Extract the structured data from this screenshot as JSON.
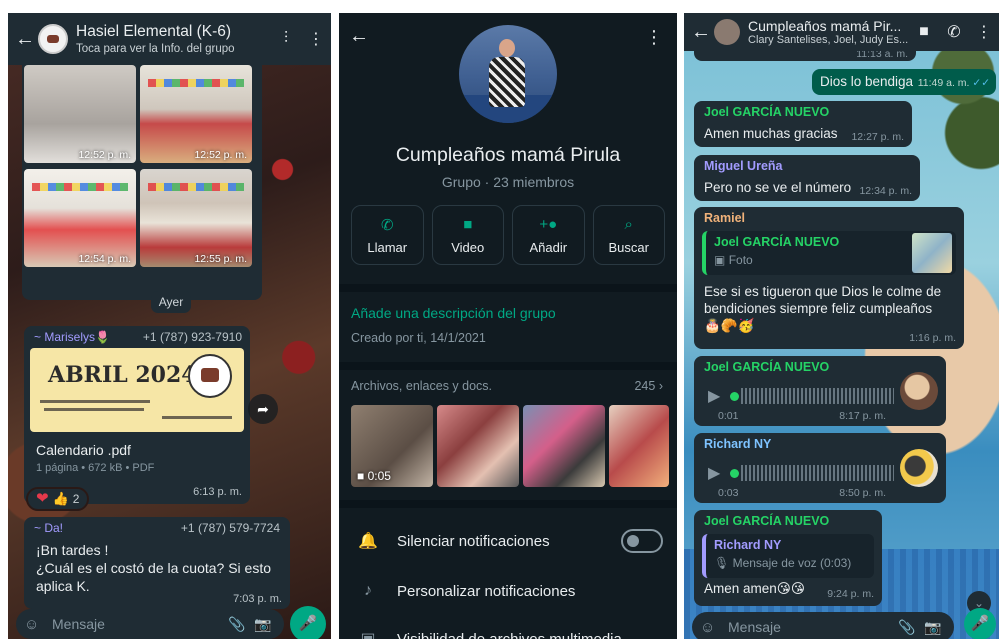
{
  "panel1": {
    "title": "Hasiel Elemental (K-6)",
    "subtitle": "Toca para ver la Info. del grupo",
    "images": [
      {
        "time": "12:52 p. m."
      },
      {
        "time": "12:52 p. m."
      },
      {
        "time": "12:54 p. m."
      },
      {
        "time": "12:55 p. m."
      }
    ],
    "day_separator": "Ayer",
    "doc_message": {
      "sender": "~ Mariselys🌷",
      "phone": "+1 (787) 923-7910",
      "preview_title": "ABRIL 2024",
      "file_name": "Calendario .pdf",
      "file_meta": "1 página • 672 kB • PDF",
      "time": "6:13 p. m."
    },
    "reactions": {
      "emoji1": "❤",
      "emoji2": "👍",
      "count": "2"
    },
    "text_message": {
      "sender": "~ Da!",
      "phone": "+1 (787) 579-7724",
      "line1": "¡Bn tardes !",
      "line2": "¿Cuál es el costó de la cuota? Si esto",
      "line3": "aplica K.",
      "time": "7:03 p. m."
    },
    "input_placeholder": "Mensaje"
  },
  "panel2": {
    "group_name": "Cumpleaños mamá Pirula",
    "group_meta": "Grupo · 23 miembros",
    "actions": [
      {
        "label": "Llamar",
        "icon": "phone-icon"
      },
      {
        "label": "Video",
        "icon": "video-icon"
      },
      {
        "label": "Añadir",
        "icon": "add-person-icon"
      },
      {
        "label": "Buscar",
        "icon": "search-icon"
      }
    ],
    "description_link": "Añade una descripción del grupo",
    "created": "Creado por ti, 14/1/2021",
    "media_header": "Archivos, enlaces y docs.",
    "media_count": "245",
    "media_video_duration": "0:05",
    "settings": [
      {
        "label": "Silenciar notificaciones"
      },
      {
        "label": "Personalizar notificaciones"
      },
      {
        "label": "Visibilidad de archivos multimedia"
      }
    ]
  },
  "panel3": {
    "title": "Cumpleaños mamá Pir...",
    "subtitle": "Clary Santelises, Joel, Judy Es...",
    "top_time": "11:13 a. m.",
    "outgoing": {
      "text": "Dios lo bendiga",
      "time": "11:49 a. m."
    },
    "messages": {
      "m1": {
        "sender": "Joel GARCÍA NUEVO",
        "text": "Amen muchas gracias",
        "time": "12:27 p. m."
      },
      "m2": {
        "sender": "Miguel Ureña",
        "text": "Pero no se ve el número",
        "time": "12:34 p. m."
      },
      "m3": {
        "sender": "Ramiel",
        "quote_sender": "Joel GARCÍA NUEVO",
        "quote_text": "Foto",
        "line1": "Ese si es tigueron que Dios le colme de",
        "line2": "bendiciones siempre feliz cumpleaños",
        "emojis": "🎂🥐🥳",
        "time": "1:16 p. m."
      },
      "m4": {
        "sender": "Joel GARCÍA NUEVO",
        "duration": "0:01",
        "time": "8:17 p. m."
      },
      "m5": {
        "sender": "Richard NY",
        "duration": "0:03",
        "time": "8:50 p. m."
      },
      "m6": {
        "sender": "Joel GARCÍA NUEVO",
        "quote_sender": "Richard NY",
        "quote_text": "Mensaje de voz (0:03)",
        "text": "Amen amen😘😘",
        "time": "9:24 p. m."
      }
    },
    "input_placeholder": "Mensaje"
  }
}
